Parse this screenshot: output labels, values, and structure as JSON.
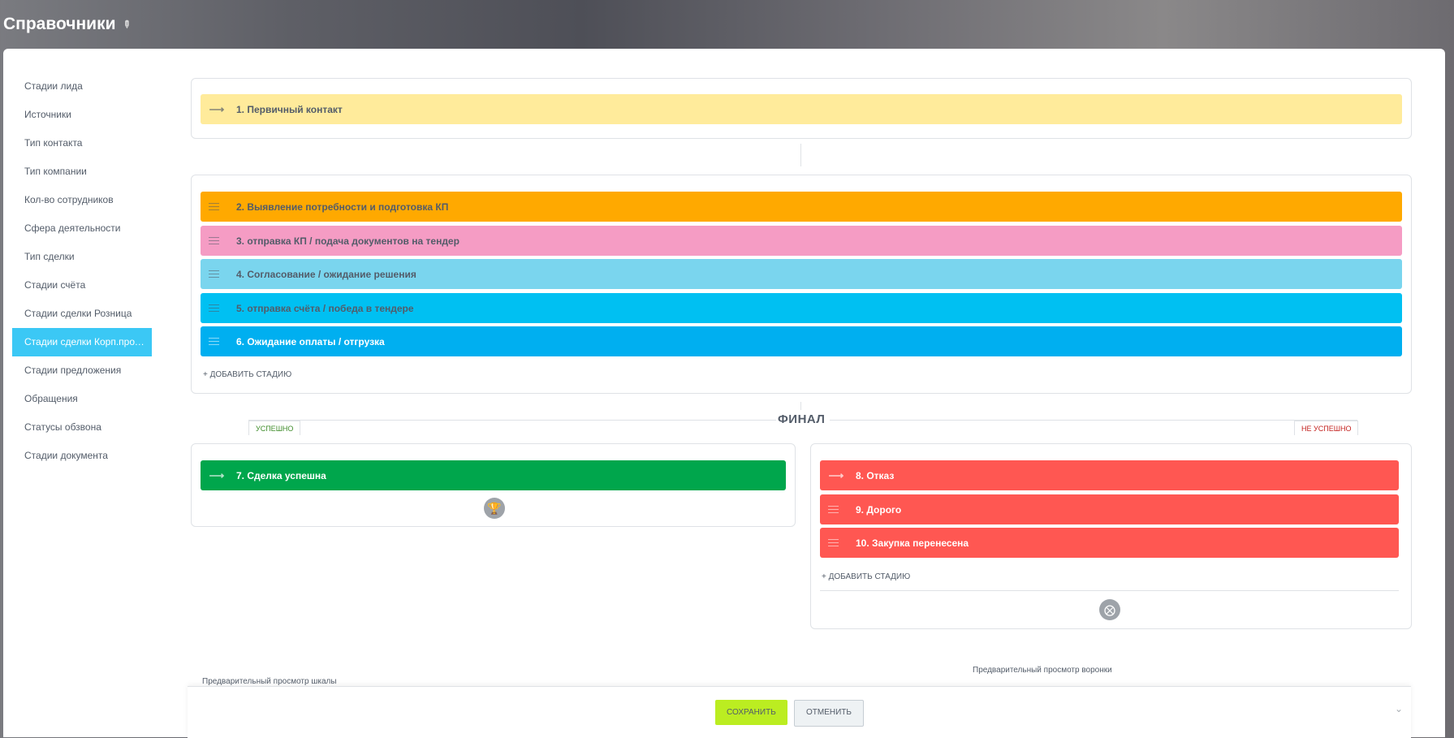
{
  "header": {
    "title": "Справочники",
    "pin_icon": "pin-icon"
  },
  "sidebar": {
    "items": [
      {
        "label": "Стадии лида"
      },
      {
        "label": "Источники"
      },
      {
        "label": "Тип контакта"
      },
      {
        "label": "Тип компании"
      },
      {
        "label": "Кол-во сотрудников"
      },
      {
        "label": "Сфера деятельности"
      },
      {
        "label": "Тип сделки"
      },
      {
        "label": "Стадии счёта"
      },
      {
        "label": "Стадии сделки Розница"
      },
      {
        "label": "Стадии сделки Корп.прода..."
      },
      {
        "label": "Стадии предложения"
      },
      {
        "label": "Обращения"
      },
      {
        "label": "Статусы обзвона"
      },
      {
        "label": "Стадии документа"
      }
    ],
    "active_index": 9,
    "active_color": "#3bc8f5"
  },
  "first_stage": {
    "label": "1. Первичный контакт",
    "color": "#ffeb9b",
    "icon": "arrow-right-icon"
  },
  "stages": [
    {
      "label": "2. Выявление потребности и подготовка КП",
      "color": "#ffa900"
    },
    {
      "label": "3. отправка КП / подача документов на тендер",
      "color": "#f59cc4"
    },
    {
      "label": "4. Согласование / ожидание решения",
      "color": "#7ad5ee"
    },
    {
      "label": "5. отправка счёта / победа в тендере",
      "color": "#00c0f2"
    },
    {
      "label": "6. Ожидание оплаты / отгрузка",
      "color": "#00aff0"
    }
  ],
  "add_stage_label": "+ ДОБАВИТЬ СТАДИЮ",
  "final": {
    "title": "ФИНАЛ",
    "success_label": "УСПЕШНО",
    "fail_label": "НЕ УСПЕШНО",
    "success_color": "#3e8c2a",
    "fail_color": "#c3201d",
    "success_stage": {
      "label": "7. Сделка успешна",
      "color": "#00a64c"
    },
    "fail_stages": [
      {
        "label": "8. Отказ",
        "color": "#ff5752"
      },
      {
        "label": "9. Дорого",
        "color": "#ff5752"
      },
      {
        "label": "10. Закупка перенесена",
        "color": "#ff5752"
      }
    ],
    "success_icon": "trophy-icon",
    "fail_icon": "cancel-circle-icon"
  },
  "preview": {
    "funnel_label": "Предварительный просмотр воронки",
    "scale_label": "Предварительный просмотр шкалы"
  },
  "footer": {
    "save_label": "СОХРАНИТЬ",
    "cancel_label": "ОТМЕНИТЬ"
  }
}
